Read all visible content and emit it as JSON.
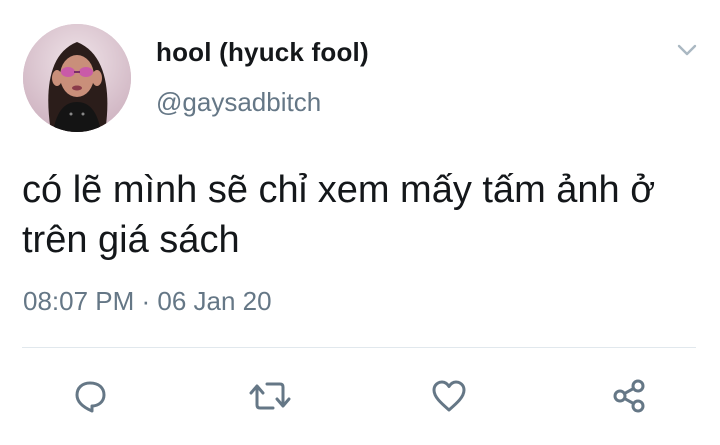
{
  "tweet": {
    "display_name": "hool (hyuck fool)",
    "handle": "@gaysadbitch",
    "text": "có lẽ mình sẽ chỉ xem mấy tấm ảnh ở trên giá sách",
    "timestamp": "08:07 PM · 06 Jan 20"
  },
  "icons": {
    "more": "chevron-down-icon",
    "reply": "reply-icon",
    "retweet": "retweet-icon",
    "like": "heart-icon",
    "share": "share-icon"
  },
  "colors": {
    "primary_text": "#14171a",
    "secondary_text": "#657786",
    "divider": "#e1e8ed",
    "icon": "#657786"
  }
}
